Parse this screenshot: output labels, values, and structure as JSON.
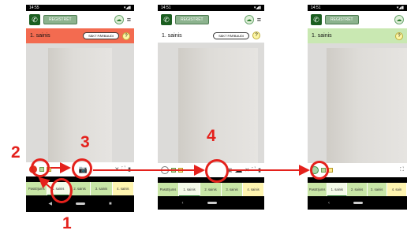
{
  "phones": [
    {
      "time": "14:55",
      "call_button": "REGISTRĒT",
      "title": "1. sainis",
      "outline_button": "SĀKT PĀRBAUDI",
      "help": "?",
      "tabs": [
        "Pasūtījums",
        "1. sainis",
        "2. sainis",
        "3. sainis",
        "4. sainis"
      ],
      "header_color": "#f36b50"
    },
    {
      "time": "14:51",
      "call_button": "REGISTRĒT",
      "title": "1. sainis",
      "outline_button": "SĀKT PĀRBAUDI",
      "help": "?",
      "tabs": [
        "Pasūtījums",
        "1. sainis",
        "2. sainis",
        "3. sainis",
        "4. sainis"
      ],
      "header_color": "#ffffff"
    },
    {
      "time": "14:51",
      "call_button": "REGISTRĒT",
      "title": "1. sainis",
      "help": "?",
      "tabs": [
        "Pasūtījums",
        "1. sainis",
        "2. sainis",
        "3. sainis",
        "4. sain"
      ],
      "header_color": "#c9e8b2"
    }
  ],
  "annotations": {
    "step1": "1",
    "step2": "2",
    "step3": "3",
    "step4": "4"
  },
  "colors": {
    "annotation_red": "#e4211c",
    "brand_green": "#1b5e20"
  }
}
